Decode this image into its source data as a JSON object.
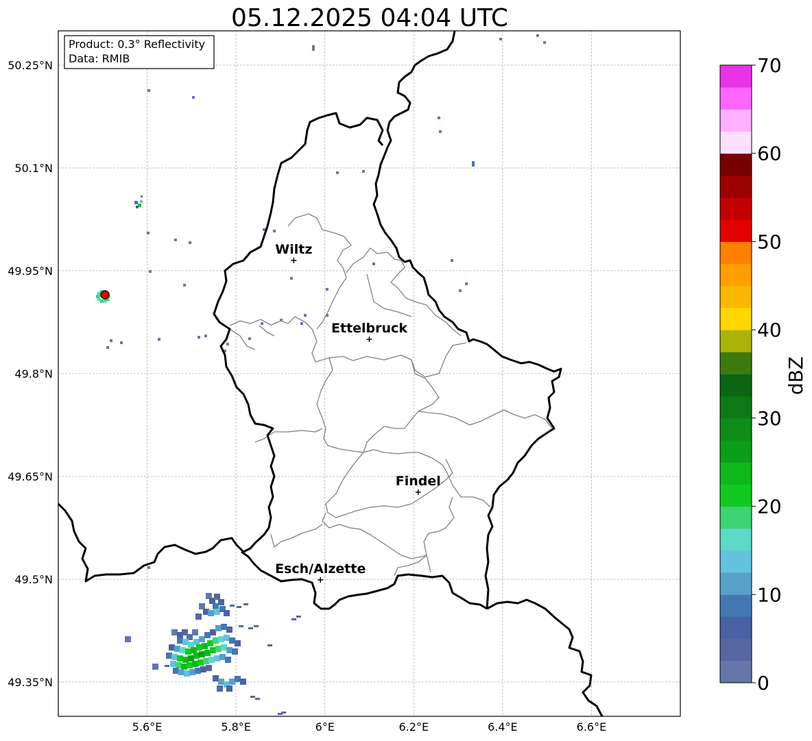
{
  "title": "05.12.2025 04:04 UTC",
  "info_box": {
    "product": "Product: 0.3° Reflectivity",
    "data": "Data: RMIB"
  },
  "axes": {
    "lon_ticks": [
      "5.6°E",
      "5.8°E",
      "6°E",
      "6.2°E",
      "6.4°E",
      "6.6°E"
    ],
    "lat_ticks": [
      "50.25°N",
      "50.1°N",
      "49.95°N",
      "49.8°N",
      "49.65°N",
      "49.5°N",
      "49.35°N"
    ],
    "lon_range": [
      5.4,
      6.8
    ],
    "lat_range": [
      49.3,
      50.3
    ],
    "grid": true
  },
  "colorbar": {
    "label": "dBZ",
    "tick_labels": [
      "0",
      "10",
      "20",
      "30",
      "40",
      "50",
      "60",
      "70"
    ],
    "min": 0,
    "max": 70,
    "step": 2.5,
    "colors": [
      "#6677aa",
      "#55679e",
      "#4a62a4",
      "#4377b2",
      "#56a0c9",
      "#63c2dc",
      "#5ed8c8",
      "#3dd473",
      "#12c91f",
      "#0fb81a",
      "#0c9e18",
      "#0d8d17",
      "#0b7a14",
      "#0a6612",
      "#3f7a0f",
      "#abb30a",
      "#fed700",
      "#fcb800",
      "#ff9f00",
      "#ff7f00",
      "#e50000",
      "#c30000",
      "#9d0000",
      "#770000",
      "#ffdfff",
      "#ffb0ff",
      "#ff66ff",
      "#e933e9"
    ]
  },
  "cities": [
    {
      "name": "Wiltz",
      "lon": 5.93,
      "lat": 49.965
    },
    {
      "name": "Ettelbruck",
      "lon": 6.1,
      "lat": 49.85
    },
    {
      "name": "Findel",
      "lon": 6.21,
      "lat": 49.627
    },
    {
      "name": "Esch/Alzette",
      "lon": 5.99,
      "lat": 49.499
    }
  ],
  "radar_site": {
    "lon": 5.505,
    "lat": 49.915,
    "color": "#e00000"
  }
}
